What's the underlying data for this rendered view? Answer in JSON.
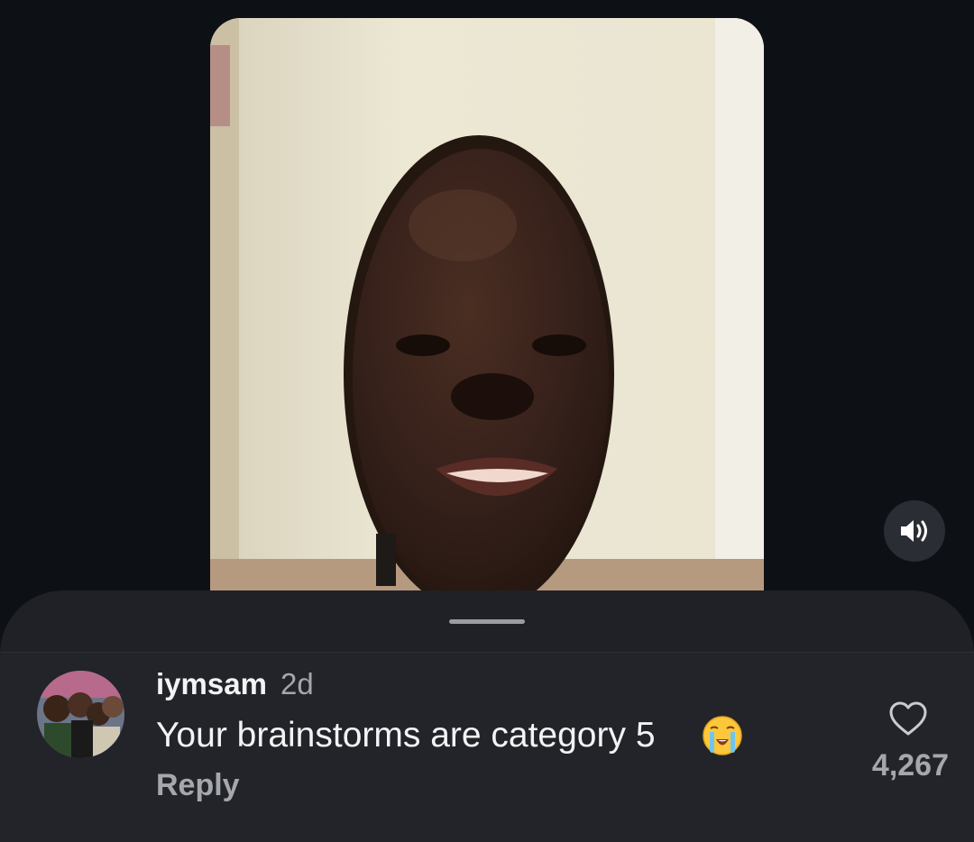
{
  "video": {
    "description_icon": "video-frame",
    "mute_icon": "speaker-on-icon"
  },
  "sheet": {
    "grabber_icon": "drag-handle"
  },
  "comment": {
    "username": "iymsam",
    "timestamp": "2d",
    "text": "Your brainstorms are category 5",
    "emoji": "loudly-crying-face",
    "reply_label": "Reply",
    "like_icon": "heart-outline-icon",
    "like_count": "4,267"
  },
  "colors": {
    "background": "#0d1014",
    "sheet": "#1f2126",
    "primary_text": "#f2f3f5",
    "secondary_text": "#a4a7ad"
  }
}
